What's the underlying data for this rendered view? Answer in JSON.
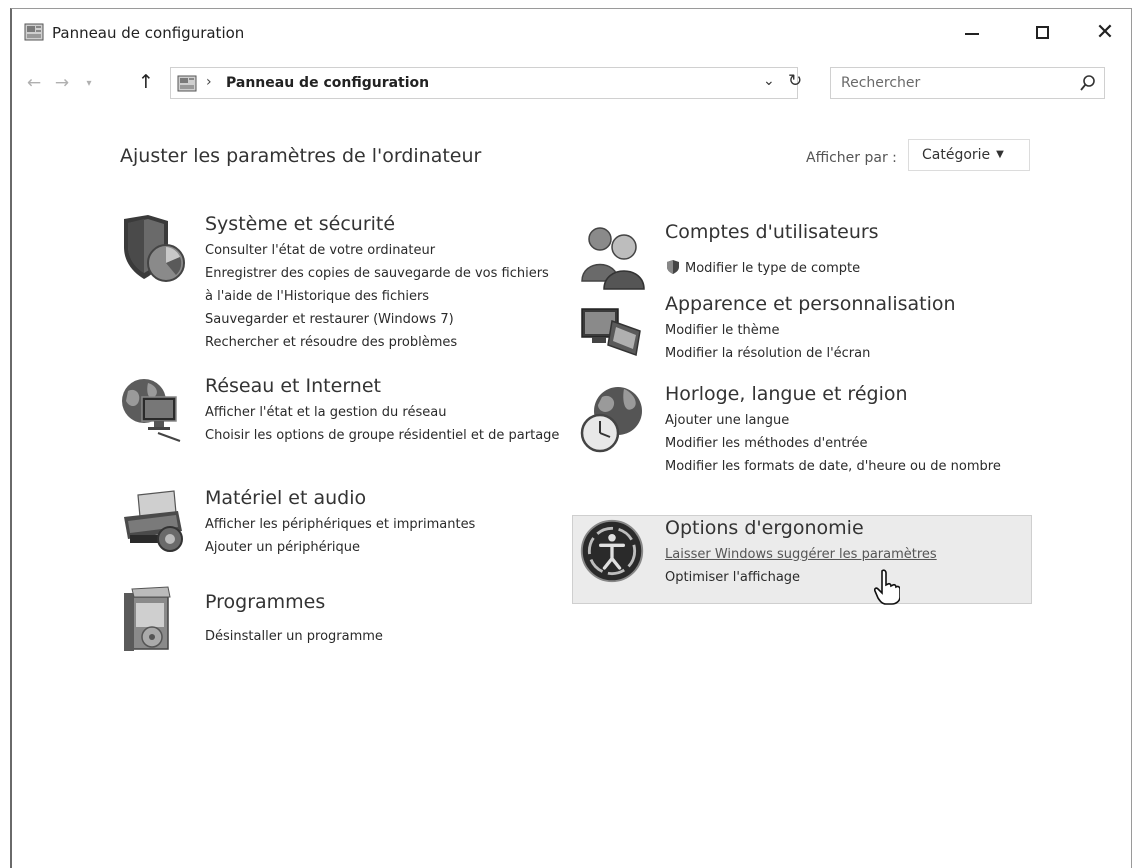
{
  "window": {
    "title": "Panneau de configuration",
    "minimize_label": "—",
    "maximize_label": "",
    "close_label": "✕"
  },
  "navigation": {
    "back_label": "←",
    "forward_label": "→",
    "recent_label": "▾",
    "up_label": "↑",
    "separator": "›",
    "breadcrumb": "Panneau de configuration",
    "address_dropdown": "⌄",
    "refresh_label": "↻"
  },
  "search": {
    "placeholder": "Rechercher"
  },
  "header": {
    "title": "Ajuster les paramètres de l'ordinateur",
    "view_by_label": "Afficher par :",
    "view_by_value": "Catégorie"
  },
  "categories": {
    "system": {
      "icon": "system-security-icon",
      "title": "Système et sécurité",
      "links": [
        "Consulter l'état de votre ordinateur",
        "Enregistrer des copies de sauvegarde de vos fichiers à l'aide de l'Historique des fichiers",
        "Sauvegarder et restaurer (Windows 7)",
        "Rechercher et résoudre des problèmes"
      ]
    },
    "network": {
      "icon": "network-internet-icon",
      "title": "Réseau et Internet",
      "links": [
        "Afficher l'état et la gestion du réseau",
        "Choisir les options de groupe résidentiel et de partage"
      ]
    },
    "hardware": {
      "icon": "hardware-sound-icon",
      "title": "Matériel et audio",
      "links": [
        "Afficher les périphériques et imprimantes",
        "Ajouter un périphérique"
      ]
    },
    "programs": {
      "icon": "programs-icon",
      "title": "Programmes",
      "links": [
        "Désinstaller un programme"
      ]
    },
    "accounts": {
      "icon": "user-accounts-icon",
      "title": "Comptes d'utilisateurs",
      "links": [
        "Modifier le type de compte"
      ]
    },
    "appearance": {
      "icon": "appearance-icon",
      "title": "Apparence et personnalisation",
      "links": [
        "Modifier le thème",
        "Modifier la résolution de l'écran"
      ]
    },
    "clock": {
      "icon": "clock-language-region-icon",
      "title": "Horloge, langue et région",
      "links": [
        "Ajouter une langue",
        "Modifier les méthodes d'entrée",
        "Modifier les formats de date, d'heure ou de nombre"
      ]
    },
    "ease": {
      "icon": "ease-of-access-icon",
      "title": "Options d'ergonomie",
      "links": [
        "Laisser Windows suggérer les paramètres",
        "Optimiser l'affichage"
      ]
    }
  }
}
